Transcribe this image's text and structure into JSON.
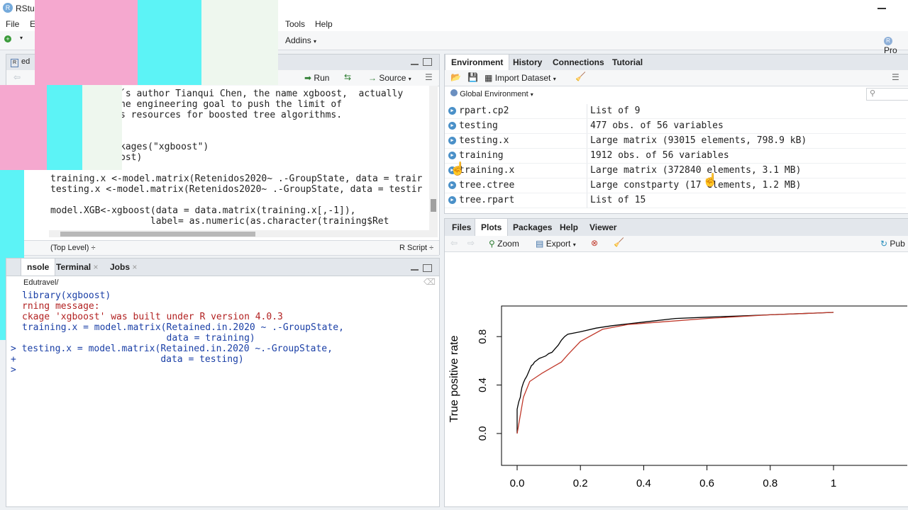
{
  "window": {
    "title": "RStu"
  },
  "menu": {
    "file": "File",
    "edit": "E",
    "tools": "Tools",
    "help": "Help",
    "addins": "Addins",
    "project": "Pro"
  },
  "editor": {
    "tab_label": "ed",
    "run_label": "Run",
    "source_label": "Source",
    "status_left": "(Top Level) ÷",
    "status_right": "R Script ÷",
    "lines": [
      "´s author Tianqui Chen, the name xgboost,  actually",
      "he engineering goal to push the limit of",
      "s resources for boosted tree algorithms.",
      "",
      "",
      "kages(\"xgboost\")",
      "ost)",
      "",
      "training.x <-model.matrix(Retenidos2020~ .-GroupState, data = trair",
      "testing.x <-model.matrix(Retenidos2020~ .-GroupState, data = testir",
      "",
      "model.XGB<-xgboost(data = data.matrix(training.x[,-1]),",
      "                  label= as.numeric(as.character(training$Ret"
    ]
  },
  "console": {
    "tabs": [
      "nsole",
      "Terminal",
      "Jobs"
    ],
    "path": "Edutravel/",
    "lines": [
      {
        "text": "library(xgboost)",
        "color": "#1a3fa6"
      },
      {
        "text": "rning message:",
        "color": "#b22222"
      },
      {
        "text": "ckage 'xgboost' was built under R version 4.0.3",
        "color": "#b22222"
      },
      {
        "text": "training.x = model.matrix(Retained.in.2020 ~ .-GroupState,",
        "color": "#1a3fa6"
      },
      {
        "text": "                          data = training)",
        "color": "#1a3fa6"
      },
      {
        "text": "> testing.x = model.matrix(Retained.in.2020 ~.-GroupState,",
        "color": "#1a3fa6"
      },
      {
        "text": "+                          data = testing)",
        "color": "#1a3fa6"
      },
      {
        "text": ">",
        "color": "#1a3fa6"
      }
    ]
  },
  "env": {
    "tabs": [
      "Environment",
      "History",
      "Connections",
      "Tutorial"
    ],
    "import_label": "Import Dataset",
    "scope_label": "Global Environment",
    "rows": [
      {
        "name": "rpart.cp2",
        "value": "List of 9"
      },
      {
        "name": "testing",
        "value": "477 obs. of 56 variables"
      },
      {
        "name": "testing.x",
        "value": "Large matrix (93015 elements, 798.9 kB)"
      },
      {
        "name": "training",
        "value": "1912 obs. of 56 variables"
      },
      {
        "name": "training.x",
        "value": "Large matrix (372840 elements, 3.1 MB)"
      },
      {
        "name": "tree.ctree",
        "value": "Large constparty (17 elements, 1.2 MB)"
      },
      {
        "name": "tree.rpart",
        "value": "List of 15"
      }
    ]
  },
  "files": {
    "tabs": [
      "Files",
      "Plots",
      "Packages",
      "Help",
      "Viewer"
    ],
    "zoom_label": "Zoom",
    "export_label": "Export",
    "publish_label": "Pub"
  },
  "chart_data": {
    "type": "line",
    "title": "",
    "xlabel": "False positive rate",
    "ylabel": "True positive rate",
    "xlim": [
      0,
      1
    ],
    "ylim": [
      0,
      1
    ],
    "xticks": [
      "0.0",
      "0.2",
      "0.4",
      "0.6",
      "0.8",
      "1"
    ],
    "yticks": [
      "0.0",
      "0.4",
      "0.8"
    ],
    "series": [
      {
        "color": "#000000",
        "x": [
          0,
          0,
          0.005,
          0.01,
          0.012,
          0.015,
          0.02,
          0.025,
          0.03,
          0.035,
          0.04,
          0.045,
          0.05,
          0.055,
          0.06,
          0.07,
          0.08,
          0.09,
          0.1,
          0.11,
          0.12,
          0.13,
          0.14,
          0.15,
          0.16,
          0.2,
          0.25,
          0.3,
          0.4,
          0.5,
          0.6,
          0.7,
          0.8,
          0.9,
          1.0
        ],
        "y": [
          0,
          0.2,
          0.26,
          0.3,
          0.34,
          0.38,
          0.42,
          0.45,
          0.47,
          0.5,
          0.53,
          0.56,
          0.57,
          0.59,
          0.6,
          0.62,
          0.63,
          0.64,
          0.66,
          0.67,
          0.7,
          0.73,
          0.77,
          0.8,
          0.82,
          0.84,
          0.87,
          0.89,
          0.92,
          0.95,
          0.96,
          0.97,
          0.98,
          0.99,
          1.0
        ]
      },
      {
        "color": "#c0392b",
        "x": [
          0,
          0.02,
          0.04,
          0.08,
          0.12,
          0.14,
          0.16,
          0.2,
          0.27,
          0.35,
          0.45,
          0.6,
          0.8,
          1.0
        ],
        "y": [
          0,
          0.3,
          0.43,
          0.5,
          0.56,
          0.59,
          0.65,
          0.76,
          0.86,
          0.9,
          0.92,
          0.95,
          0.98,
          1.0
        ]
      }
    ]
  }
}
